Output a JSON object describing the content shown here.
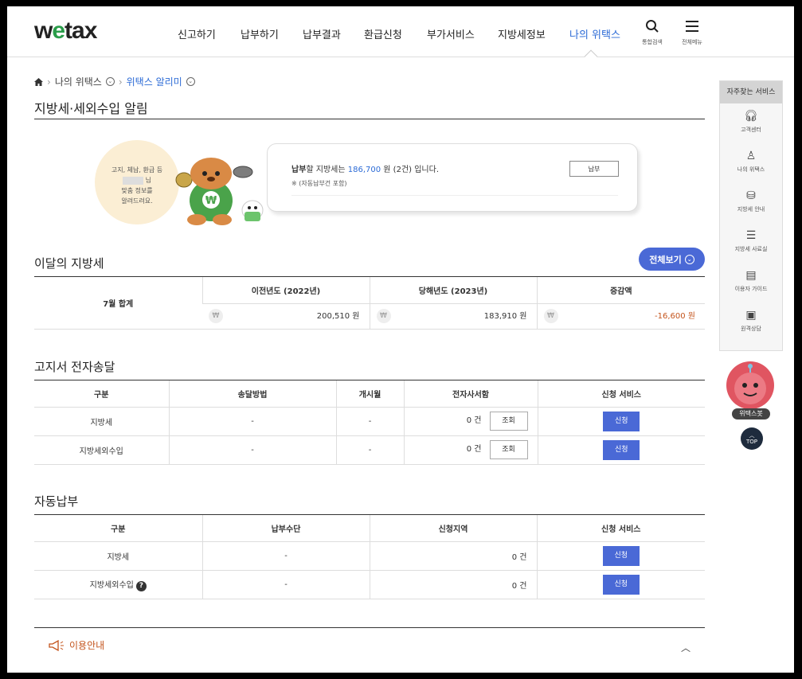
{
  "header": {
    "logo": "wetax",
    "logo_pre": "w",
    "logo_e": "e",
    "logo_post": "tax",
    "nav": [
      "신고하기",
      "납부하기",
      "납부결과",
      "환급신청",
      "부가서비스",
      "지방세정보",
      "나의 위택스"
    ],
    "search_label": "통합검색",
    "menu_label": "전체메뉴"
  },
  "breadcrumb": {
    "level1": "나의 위택스",
    "level2": "위택스 알리미"
  },
  "page_title": "지방세·세외수입 알림",
  "notice": {
    "bubble_l1": "고지, 체납, 환급 등",
    "bubble_l2": "님",
    "bubble_l3": "맞춤 정보를",
    "bubble_l4": "알려드려요.",
    "pre": "납부",
    "mid": "할 지방세는 ",
    "amount": "186,700",
    "post": " 원 (2건) 입니다.",
    "note": "※ (자동납부건 포함)",
    "pay_button": "납부"
  },
  "monthly": {
    "title": "이달의 지방세",
    "view_all": "전체보기",
    "row_label": "7월 합계",
    "headers": [
      "이전년도 (2022년)",
      "당해년도 (2023년)",
      "증감액"
    ],
    "values": [
      "200,510 원",
      "183,910 원",
      "-16,600 원"
    ],
    "won": "₩"
  },
  "ebill": {
    "title": "고지서 전자송달",
    "headers": [
      "구분",
      "송달방법",
      "개시월",
      "전자사서함",
      "신청 서비스"
    ],
    "rows": [
      {
        "type": "지방세",
        "method": "-",
        "start": "-",
        "count": "0 건",
        "inquiry": "조회",
        "apply": "신청"
      },
      {
        "type": "지방세외수입",
        "method": "-",
        "start": "-",
        "count": "0 건",
        "inquiry": "조회",
        "apply": "신청"
      }
    ]
  },
  "autopay": {
    "title": "자동납부",
    "headers": [
      "구분",
      "납부수단",
      "신청지역",
      "신청 서비스"
    ],
    "rows": [
      {
        "type": "지방세",
        "means": "-",
        "count": "0 건",
        "apply": "신청"
      },
      {
        "type": "지방세외수입",
        "means": "-",
        "count": "0 건",
        "apply": "신청",
        "help": "?"
      }
    ]
  },
  "guide": {
    "label": "이용안내"
  },
  "sidebar": {
    "title": "자주찾는 서비스",
    "items": [
      "고객센터",
      "나의 위택스",
      "지방세 안내",
      "지방세 사료실",
      "이용자 가이드",
      "원격상담"
    ],
    "bot": "위택스봇",
    "top": "TOP"
  },
  "colors": {
    "accent": "#4a69d6",
    "link": "#2c6bd6",
    "negative": "#c4541c",
    "logo_e": "#2a9d4a"
  }
}
